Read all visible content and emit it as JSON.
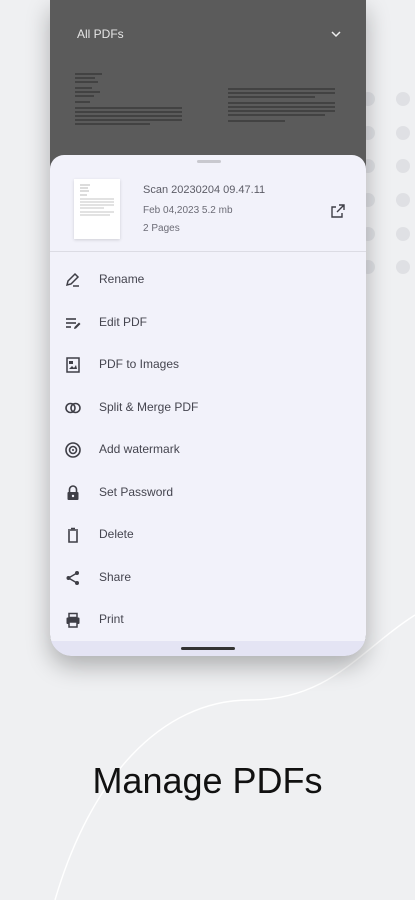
{
  "colors": {
    "background": "#eff0f2",
    "sheet": "#f2f2fa",
    "dim_overlay": "#5b5b5b",
    "text_primary": "#45454f",
    "icon": "#3e3e46"
  },
  "file_list": {
    "filter_label": "All PDFs",
    "filter_icon": "chevron-down-icon"
  },
  "file": {
    "name": "Scan 20230204  09.47.11",
    "meta": "Feb 04,2023  5.2 mb",
    "pages": "2 Pages",
    "open_icon": "open-external-icon"
  },
  "menu": [
    {
      "label": "Rename",
      "icon": "rename-pencil-icon"
    },
    {
      "label": "Edit PDF",
      "icon": "edit-pdf-icon"
    },
    {
      "label": "PDF to Images",
      "icon": "pdf-to-images-icon"
    },
    {
      "label": "Split & Merge PDF",
      "icon": "split-merge-icon"
    },
    {
      "label": "Add watermark",
      "icon": "watermark-icon"
    },
    {
      "label": "Set Password",
      "icon": "lock-icon"
    },
    {
      "label": "Delete",
      "icon": "trash-icon"
    },
    {
      "label": "Share",
      "icon": "share-icon"
    },
    {
      "label": "Print",
      "icon": "printer-icon"
    }
  ],
  "headline": "Manage PDFs"
}
